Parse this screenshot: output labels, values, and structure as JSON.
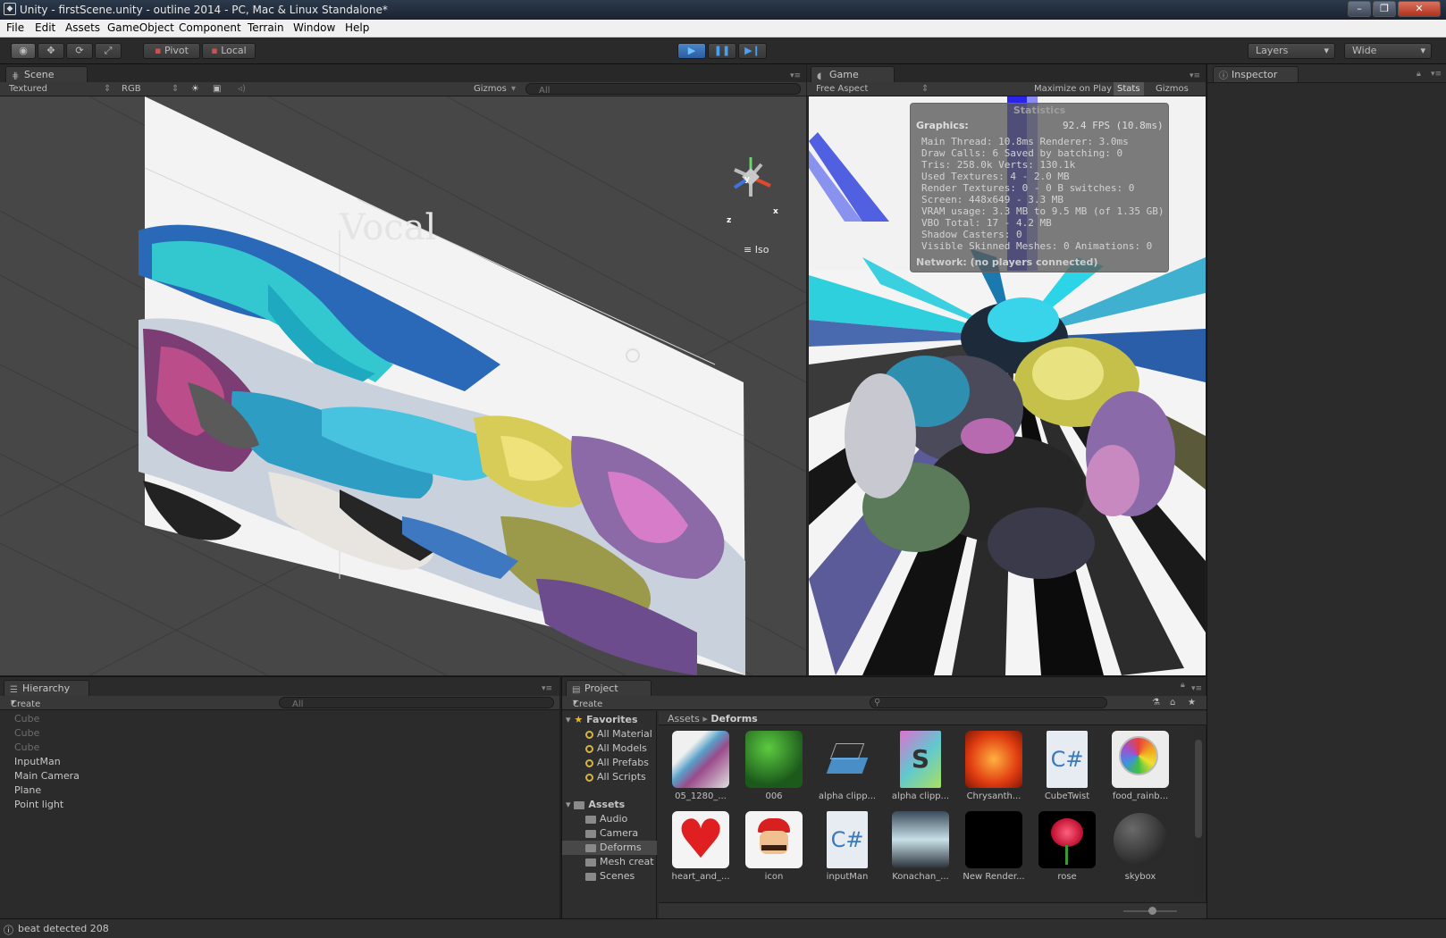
{
  "window": {
    "title": "Unity - firstScene.unity - outline 2014 - PC, Mac & Linux Standalone*"
  },
  "menu": [
    "File",
    "Edit",
    "Assets",
    "GameObject",
    "Component",
    "Terrain",
    "Window",
    "Help"
  ],
  "toolbar": {
    "pivot": "Pivot",
    "local": "Local",
    "layers": "Layers",
    "layout": "Wide"
  },
  "scene": {
    "tab": "Scene",
    "render_mode": "Textured",
    "color_mode": "RGB",
    "gizmos": "Gizmos",
    "search_placeholder": "All",
    "iso_label": "Iso",
    "gizmo_axes": {
      "y": "y",
      "x": "x",
      "z": "z"
    }
  },
  "game": {
    "tab": "Game",
    "aspect": "Free Aspect",
    "maximize": "Maximize on Play",
    "stats": "Stats",
    "gizmos": "Gizmos"
  },
  "statistics": {
    "title": "Statistics",
    "graphics_label": "Graphics:",
    "fps": "92.4 FPS (10.8ms)",
    "lines": [
      "Main Thread: 10.8ms  Renderer: 3.0ms",
      "Draw Calls: 6   Saved by batching: 0",
      "Tris: 258.0k     Verts: 130.1k",
      "Used Textures: 4 - 2.0 MB",
      "Render Textures: 0 - 0 B  switches: 0",
      "Screen: 448x649 - 3.3 MB",
      "VRAM usage: 3.3 MB to 9.5 MB (of 1.35 GB)",
      "VBO Total: 17 - 4.2 MB",
      "Shadow Casters: 0",
      "Visible Skinned Meshes: 0      Animations: 0"
    ],
    "network": "Network: (no players connected)"
  },
  "inspector": {
    "tab": "Inspector"
  },
  "hierarchy": {
    "tab": "Hierarchy",
    "create": "Create",
    "search_placeholder": "All",
    "items": [
      {
        "label": "Cube",
        "dim": true
      },
      {
        "label": "Cube",
        "dim": true
      },
      {
        "label": "Cube",
        "dim": true
      },
      {
        "label": "InputMan",
        "dim": false
      },
      {
        "label": "Main Camera",
        "dim": false
      },
      {
        "label": "Plane",
        "dim": false
      },
      {
        "label": "Point light",
        "dim": false
      }
    ]
  },
  "project": {
    "tab": "Project",
    "create": "Create",
    "favorites_label": "Favorites",
    "favorites": [
      "All Material",
      "All Models",
      "All Prefabs",
      "All Scripts"
    ],
    "assets_label": "Assets",
    "folders": [
      "Audio",
      "Camera",
      "Deforms",
      "Mesh creat",
      "Scenes"
    ],
    "breadcrumb": {
      "root": "Assets",
      "current": "Deforms"
    },
    "items": [
      {
        "label": "05_1280_...",
        "kind": "image-anime"
      },
      {
        "label": "006",
        "kind": "image-leaf"
      },
      {
        "label": "alpha clipp...",
        "kind": "material-shader"
      },
      {
        "label": "alpha clipp...",
        "kind": "shader-file"
      },
      {
        "label": "Chrysanth...",
        "kind": "image-flower"
      },
      {
        "label": "CubeTwist",
        "kind": "csharp-script"
      },
      {
        "label": "food_rainb...",
        "kind": "image-lollipop"
      },
      {
        "label": "heart_and_...",
        "kind": "image-heart"
      },
      {
        "label": "icon",
        "kind": "image-mario"
      },
      {
        "label": "inputMan",
        "kind": "csharp-script"
      },
      {
        "label": "Konachan_...",
        "kind": "image-anime-dark"
      },
      {
        "label": "New Render...",
        "kind": "render-texture"
      },
      {
        "label": "rose",
        "kind": "image-rose"
      },
      {
        "label": "skybox",
        "kind": "material-sphere"
      }
    ]
  },
  "status": {
    "message": "beat detected 208"
  }
}
